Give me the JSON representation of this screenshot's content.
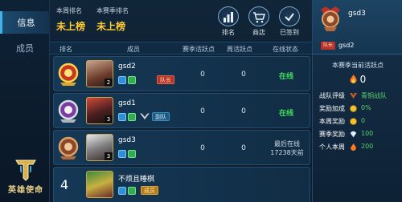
{
  "sidebar": {
    "tabs": [
      {
        "label": "信息",
        "active": true
      },
      {
        "label": "成员",
        "active": false
      }
    ],
    "logo_text": "英雄使命"
  },
  "header": {
    "week_rank_label": "本周排名",
    "week_rank_value": "未上榜",
    "season_rank_label": "本赛季排名",
    "season_rank_value": "未上榜",
    "buttons": [
      {
        "label": "排名",
        "icon": "bar-chart-icon"
      },
      {
        "label": "商店",
        "icon": "cart-icon"
      },
      {
        "label": "已签到",
        "icon": "check-icon"
      }
    ]
  },
  "table": {
    "columns": [
      "排名",
      "成员",
      "赛季活跃点",
      "周活跃点",
      "在线状态"
    ],
    "rows": [
      {
        "rank": "1",
        "name": "gsd2",
        "level": "2",
        "role": "队长",
        "season_points": "0",
        "week_points": "0",
        "status": "在线",
        "online": true
      },
      {
        "rank": "2",
        "name": "gsd1",
        "level": "3",
        "role": "副队",
        "season_points": "0",
        "week_points": "0",
        "status": "在线",
        "online": true
      },
      {
        "rank": "3",
        "name": "gsd3",
        "level": "3",
        "role": "",
        "season_points": "0",
        "week_points": "0",
        "status_line1": "最后在线",
        "status_line2": "17238天前",
        "online": false
      },
      {
        "rank": "4",
        "name": "不烦且睡棋",
        "level": "",
        "role": "成员",
        "season_points": "",
        "week_points": "",
        "status": "",
        "online": false
      }
    ]
  },
  "team_panel": {
    "team_name": "gsd3",
    "leader_tag": "队长",
    "leader_name": "gsd2",
    "season_active_label": "本赛季当前活跃点",
    "season_active_value": "0",
    "stats": [
      {
        "label": "战队评级",
        "value": "青铜战队",
        "icon": "bronze-rank-icon"
      },
      {
        "label": "奖励加成",
        "value": "0%",
        "icon": "coin-icon"
      },
      {
        "label": "本周奖励",
        "value": "0",
        "icon": "coin-icon"
      },
      {
        "label": "赛季奖励",
        "value": "100",
        "icon": "diamond-icon"
      },
      {
        "label": "个人本周",
        "value": "200",
        "icon": "flame-icon"
      }
    ]
  },
  "colors": {
    "accent_gold": "#ffcc33",
    "online_green": "#3fe05a",
    "leader_red": "#b8322c"
  }
}
